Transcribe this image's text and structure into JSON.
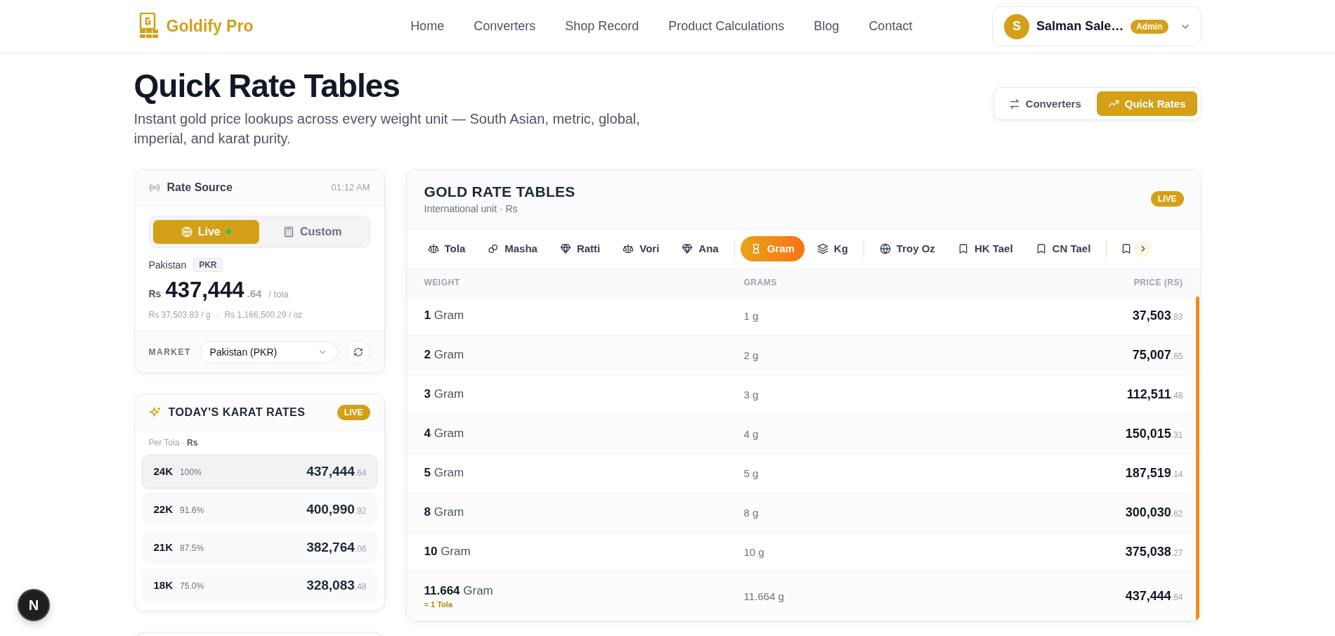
{
  "brand": {
    "name": "Goldify Pro"
  },
  "nav": [
    {
      "label": "Home"
    },
    {
      "label": "Converters"
    },
    {
      "label": "Shop Record"
    },
    {
      "label": "Product Calculations"
    },
    {
      "label": "Blog"
    },
    {
      "label": "Contact"
    }
  ],
  "user": {
    "initial": "S",
    "name": "Salman Sale…",
    "role": "Admin"
  },
  "page": {
    "title": "Quick Rate Tables",
    "subtitle": "Instant gold price lookups across every weight unit — South Asian, metric, global, imperial, and karat purity."
  },
  "view_switch": [
    {
      "label": "Converters",
      "selected": false
    },
    {
      "label": "Quick Rates",
      "selected": true
    }
  ],
  "rate_source": {
    "title": "Rate Source",
    "time": "01:12 AM",
    "modes": [
      {
        "label": "Live",
        "selected": true,
        "live_dot": true
      },
      {
        "label": "Custom",
        "selected": false,
        "live_dot": false
      }
    ],
    "country": "Pakistan",
    "currency": "PKR",
    "symbol": "Rs",
    "price_whole": "437,444",
    "price_decimal": ".64",
    "per": "/ tola",
    "sub_rates": [
      "Rs 37,503.83 / g",
      "Rs 1,166,500.29 / oz"
    ],
    "sub_rate_separator": "·",
    "market_label": "MARKET",
    "market_value": "Pakistan (PKR)"
  },
  "karat_rates": {
    "title": "TODAY'S KARAT RATES",
    "badge": "LIVE",
    "caption": "Per Tola · **Rs**",
    "rows": [
      {
        "karat": "24K",
        "purity": "100%",
        "whole": "437,444",
        "decimal": ".64",
        "selected": true
      },
      {
        "karat": "22K",
        "purity": "91.6%",
        "whole": "400,990",
        "decimal": ".92",
        "selected": false
      },
      {
        "karat": "21K",
        "purity": "87.5%",
        "whole": "382,764",
        "decimal": ".06",
        "selected": false
      },
      {
        "karat": "18K",
        "purity": "75.0%",
        "whole": "328,083",
        "decimal": ".48",
        "selected": false
      }
    ]
  },
  "rate_table": {
    "title": "GOLD RATE TABLES",
    "subtitle": "International unit · Rs",
    "badge": "LIVE",
    "tab_groups": [
      [
        {
          "label": "Tola",
          "selected": false
        },
        {
          "label": "Masha",
          "selected": false
        },
        {
          "label": "Ratti",
          "selected": false
        },
        {
          "label": "Vori",
          "selected": false
        },
        {
          "label": "Ana",
          "selected": false
        }
      ],
      [
        {
          "label": "Gram",
          "selected": true
        },
        {
          "label": "Kg",
          "selected": false
        }
      ],
      [
        {
          "label": "Troy Oz",
          "selected": false
        },
        {
          "label": "HK Tael",
          "selected": false
        },
        {
          "label": "CN Tael",
          "selected": false
        }
      ]
    ],
    "columns": [
      "WEIGHT",
      "GRAMS",
      "PRICE (RS)"
    ],
    "rows": [
      {
        "qty": "1",
        "unit": "Gram",
        "grams": "1 g",
        "whole": "37,503",
        "decimal": ".83"
      },
      {
        "qty": "2",
        "unit": "Gram",
        "grams": "2 g",
        "whole": "75,007",
        "decimal": ".65"
      },
      {
        "qty": "3",
        "unit": "Gram",
        "grams": "3 g",
        "whole": "112,511",
        "decimal": ".48"
      },
      {
        "qty": "4",
        "unit": "Gram",
        "grams": "4 g",
        "whole": "150,015",
        "decimal": ".31"
      },
      {
        "qty": "5",
        "unit": "Gram",
        "grams": "5 g",
        "whole": "187,519",
        "decimal": ".14"
      },
      {
        "qty": "8",
        "unit": "Gram",
        "grams": "8 g",
        "whole": "300,030",
        "decimal": ".62"
      },
      {
        "qty": "10",
        "unit": "Gram",
        "grams": "10 g",
        "whole": "375,038",
        "decimal": ".27"
      },
      {
        "qty": "11.664",
        "unit": "Gram",
        "note": "= 1 Tola",
        "grams": "11.664 g",
        "whole": "437,444",
        "decimal": ".64"
      }
    ]
  },
  "dev_badge": {
    "letter": "N"
  }
}
